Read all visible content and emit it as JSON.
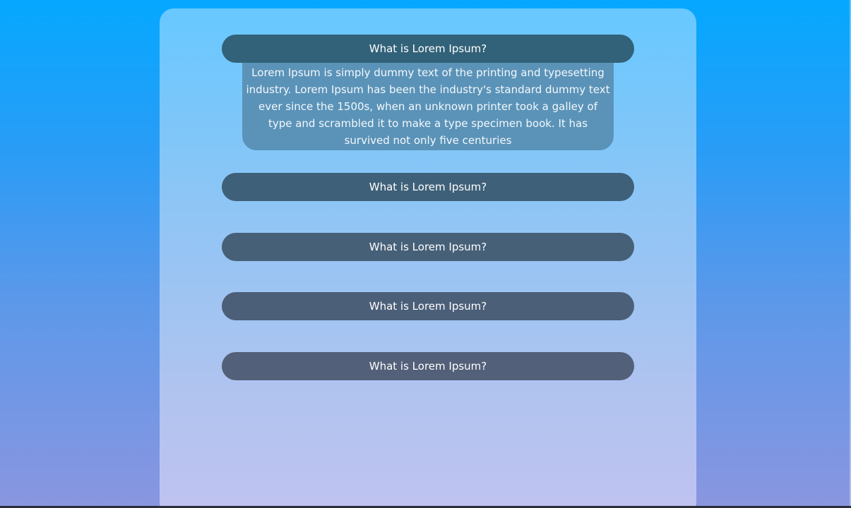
{
  "faq": {
    "items": [
      {
        "question": "What is Lorem Ipsum?",
        "answer": "Lorem Ipsum is simply dummy text of the printing and typesetting industry. Lorem Ipsum has been the industry's standard dummy text ever since the 1500s, when an unknown printer took a galley of type and scrambled it to make a type specimen book. It has survived not only five centuries",
        "expanded": true,
        "color": "#326279"
      },
      {
        "question": "What is Lorem Ipsum?",
        "expanded": false,
        "color": "#3f6079"
      },
      {
        "question": "What is Lorem Ipsum?",
        "expanded": false,
        "color": "#466078"
      },
      {
        "question": "What is Lorem Ipsum?",
        "expanded": false,
        "color": "#4c5f79"
      },
      {
        "question": "What is Lorem Ipsum?",
        "expanded": false,
        "color": "#536079"
      }
    ],
    "answer_color": "#5b93b8"
  }
}
